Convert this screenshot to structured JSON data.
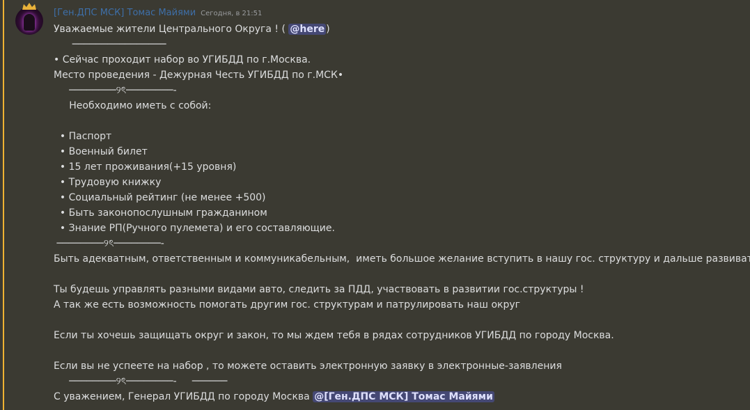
{
  "message": {
    "author": "[Ген.ДПС МСК] Томас Майями",
    "timestamp": "Сегодня, в 21:51",
    "colors": {
      "highlight": "#f0b232",
      "username": "#3e6fa8",
      "mention_bg": "#5865f2"
    },
    "lines": [
      {
        "pre": "Уважаемые жители Центрального Округа ! ( ",
        "mention": "@here",
        "post": ")"
      },
      {
        "text": "      ────────────────"
      },
      {
        "text": "• Сейчас проходит набор во УГИБДД по г.Москва."
      },
      {
        "text": "Место проведения - Дежурная Честь УГИБДД по г.МСК•"
      },
      {
        "text": "     ────────୨ৎ────────-"
      },
      {
        "text": "     Необходимо иметь с собой:"
      },
      {
        "text": ""
      },
      {
        "text": "  • Паспорт"
      },
      {
        "text": "  • Военный билет"
      },
      {
        "text": "  • 15 лет проживания(+15 уровня)"
      },
      {
        "text": "  • Трудовую книжку"
      },
      {
        "text": "  • Социальный рейтинг (не менее +500)"
      },
      {
        "text": "  • Быть законопослушным гражданином"
      },
      {
        "text": "  • Знание РП(Ручного пулемета) и его составляющие."
      },
      {
        "text": " ────────୨ৎ────────-"
      },
      {
        "text": "Быть адекватным, ответственным и коммуникабельным,  иметь большое желание вступить в нашу гос. структуру и дальше развиваться!"
      },
      {
        "text": ""
      },
      {
        "text": "Ты будешь управлять разными видами авто, следить за ПДД, участвовать в развитии гос.структуры !"
      },
      {
        "text": "А так же есть возможность помогать другим гос. структурам и патрулировать наш округ"
      },
      {
        "text": ""
      },
      {
        "text": "Если ты хочешь защищать округ и закон, то мы ждем тебя в рядах сотрудников УГИБДД по городу Москва."
      },
      {
        "text": ""
      },
      {
        "text": "Если вы не успеете на набор , то можете оставить электронную заявку в электронные-заявления"
      },
      {
        "text": "     ────────୨ৎ────────-     ──────"
      },
      {
        "pre": "С уважением, Генерал УГИБДД по городу Москва ",
        "mention": "@[Ген.ДПС МСК] Томас Майями",
        "post": ""
      }
    ]
  }
}
